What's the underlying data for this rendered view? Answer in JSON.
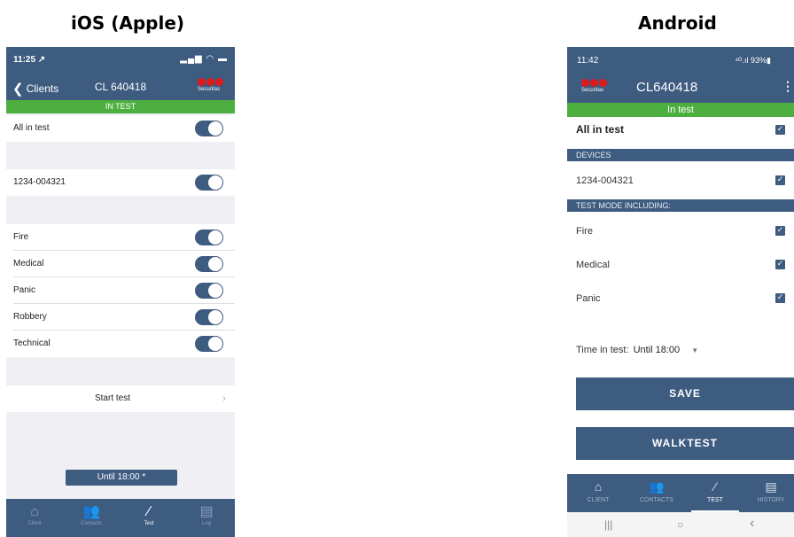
{
  "headings": {
    "ios": "iOS (Apple)",
    "android": "Android"
  },
  "ios": {
    "status_time": "11:25 ↗",
    "status_icons": "▂▄▆ ◠ ▬",
    "back_label": "Clients",
    "title": "CL 640418",
    "logo_text": "Securitas",
    "banner": "IN TEST",
    "all_in_test": "All in test",
    "device": "1234-004321",
    "alarms": [
      "Fire",
      "Medical",
      "Panic",
      "Robbery",
      "Technical"
    ],
    "start_test": "Start test",
    "until": "Until 18:00 *",
    "tabs": [
      {
        "icon": "home-icon",
        "glyph": "⌂",
        "label": "Client"
      },
      {
        "icon": "contacts-icon",
        "glyph": "👥",
        "label": "Contacts"
      },
      {
        "icon": "test-icon",
        "glyph": "⁄",
        "label": "Test"
      },
      {
        "icon": "log-icon",
        "glyph": "▤",
        "label": "Log"
      }
    ]
  },
  "android": {
    "status_time": "11:42",
    "status_right": "⁴ᴳ.ıl 93%▮",
    "logo_text": "Securitas",
    "title": "CL640418",
    "menu_glyph": "⋮",
    "banner": "In test",
    "all_in_test": "All in test",
    "devices_header": "DEVICES",
    "device": "1234-004321",
    "test_mode_header": "TEST MODE INCLUDING:",
    "alarms": [
      "Fire",
      "Medical",
      "Panic"
    ],
    "time_label": "Time in test:",
    "time_value": "Until 18:00",
    "save": "SAVE",
    "walktest": "WALKTEST",
    "tabs": [
      {
        "icon": "home-icon",
        "glyph": "⌂",
        "label": "CLIENT"
      },
      {
        "icon": "contacts-icon",
        "glyph": "👥",
        "label": "CONTACTS"
      },
      {
        "icon": "test-icon",
        "glyph": "⁄",
        "label": "TEST"
      },
      {
        "icon": "history-icon",
        "glyph": "▤",
        "label": "HISTORY"
      }
    ],
    "nav": {
      "recents": "|||",
      "home": "○",
      "back": "‹"
    }
  },
  "colors": {
    "brand_blue": "#3e5b80",
    "status_green": "#4caf3f",
    "logo_red": "#e2191a"
  }
}
